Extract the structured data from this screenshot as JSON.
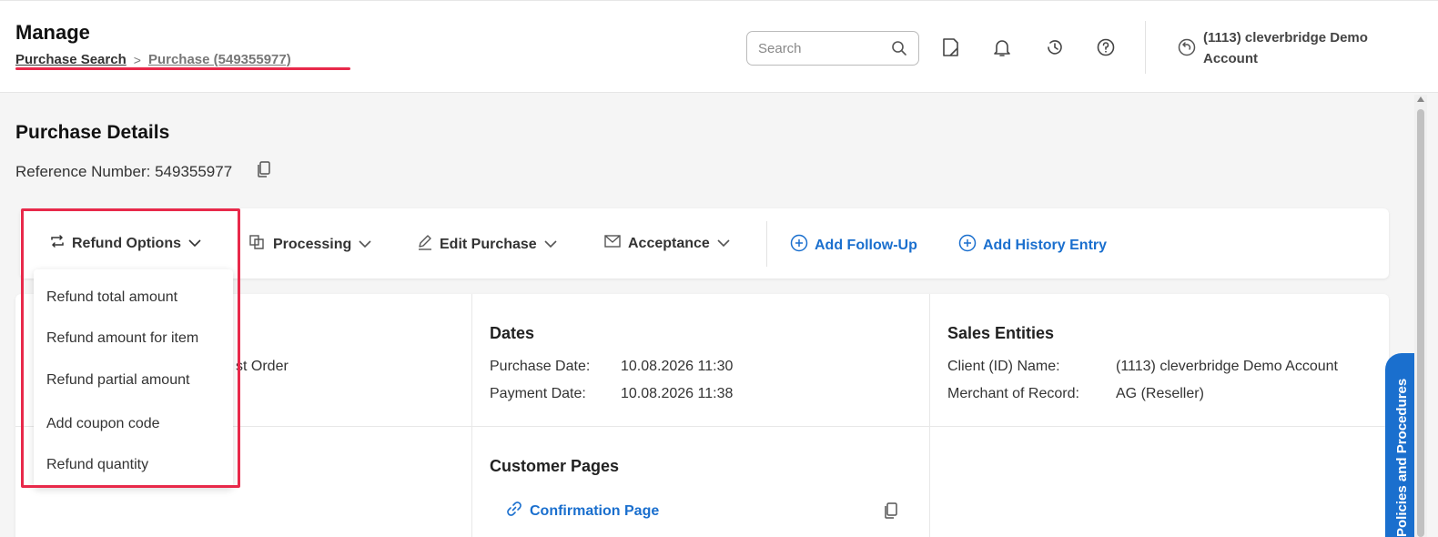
{
  "header": {
    "title": "Manage",
    "breadcrumb": {
      "parent": "Purchase Search",
      "separator": ">",
      "current": "Purchase (549355977)"
    },
    "search_placeholder": "Search",
    "account_name": "(1113) cleverbridge Demo Account"
  },
  "page": {
    "title": "Purchase Details",
    "reference_label": "Reference Number:",
    "reference_number": "549355977"
  },
  "actions": {
    "refund_options": "Refund Options",
    "processing": "Processing",
    "edit_purchase": "Edit Purchase",
    "acceptance": "Acceptance",
    "add_follow_up": "Add Follow-Up",
    "add_history_entry": "Add History Entry"
  },
  "refund_menu": {
    "items": [
      "Refund total amount",
      "Refund amount for item",
      "Refund partial amount",
      "Add coupon code",
      "Refund quantity"
    ]
  },
  "details": {
    "partial_text": "st Order",
    "dates": {
      "heading": "Dates",
      "purchase_date_label": "Purchase Date:",
      "purchase_date": "10.08.2026 11:30",
      "payment_date_label": "Payment Date:",
      "payment_date": "10.08.2026 11:38"
    },
    "sales_entities": {
      "heading": "Sales Entities",
      "client_label": "Client (ID) Name:",
      "client_value": "(1113) cleverbridge Demo Account",
      "merchant_label": "Merchant of Record:",
      "merchant_value": "AG (Reseller)"
    },
    "customer_pages": {
      "heading": "Customer Pages",
      "confirmation_link": "Confirmation Page"
    }
  },
  "side_tab": "Policies and Procedures",
  "colors": {
    "accent_link": "#1a6fce",
    "highlight": "#e8294a"
  }
}
